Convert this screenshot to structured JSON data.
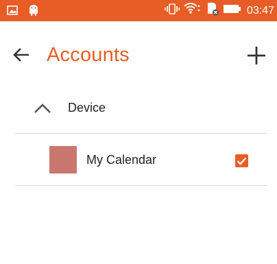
{
  "status_bar": {
    "time": "03:47",
    "icons": [
      "image-icon",
      "android-icon",
      "vibrate-icon",
      "wifi-icon",
      "sd-card-icon",
      "battery-icon"
    ]
  },
  "toolbar": {
    "title": "Accounts",
    "back_icon": "arrow-back-icon",
    "add_icon": "plus-icon"
  },
  "groups": [
    {
      "label": "Device",
      "expanded": true,
      "calendars": [
        {
          "name": "My Calendar",
          "color": "#c9766e",
          "checked": true
        }
      ]
    }
  ],
  "colors": {
    "accent": "#e85d25",
    "text": "#222222",
    "divider": "#d6d6d6"
  }
}
